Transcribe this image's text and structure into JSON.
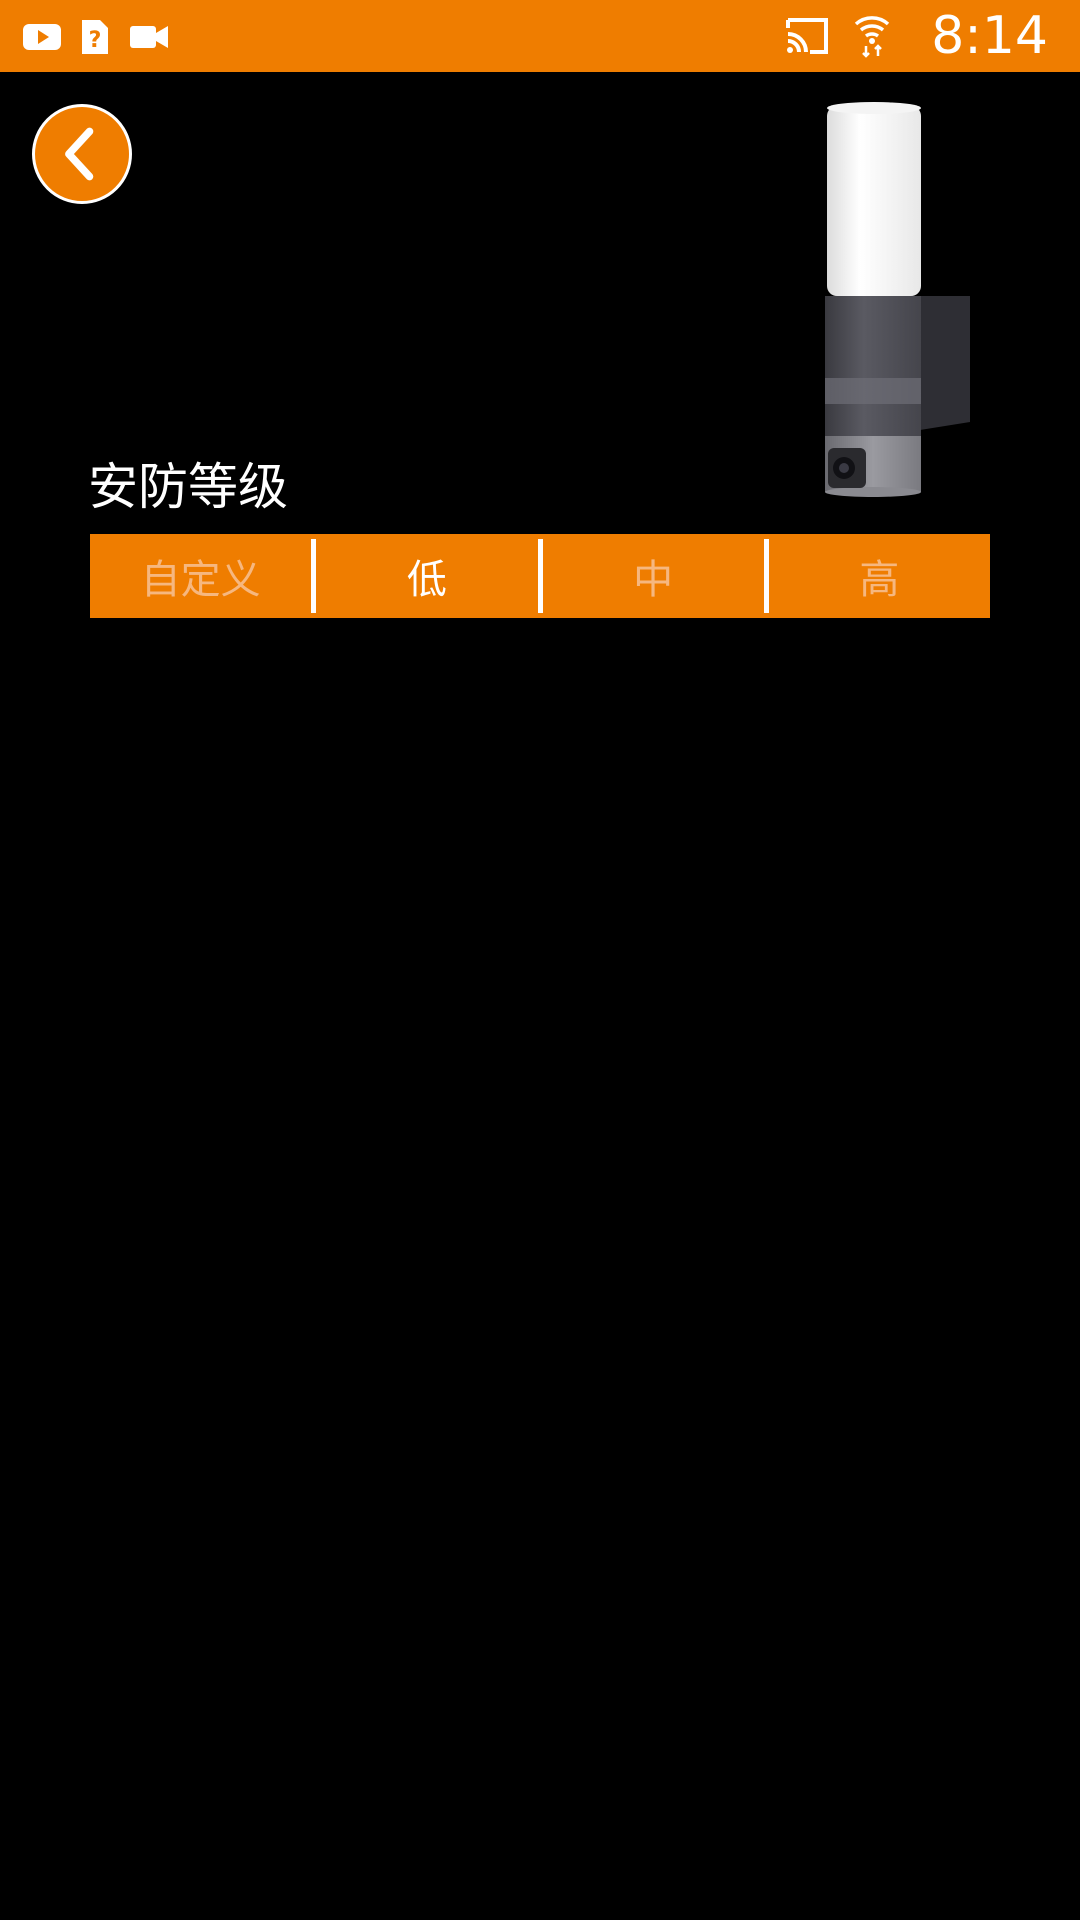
{
  "status_bar": {
    "background_color": "#EF7D00",
    "left_icons": [
      "youtube-icon",
      "sim-unknown-icon",
      "video-camera-icon"
    ],
    "right_icons": [
      "cast-icon",
      "wifi-icon"
    ],
    "time": "8:14"
  },
  "header": {
    "back_button_icon": "chevron-left-icon"
  },
  "device_image": {
    "description_icon": "outdoor-camera-light-icon"
  },
  "security_level": {
    "title": "安防等级",
    "options": [
      {
        "label": "自定义",
        "selected": false
      },
      {
        "label": "低",
        "selected": true
      },
      {
        "label": "中",
        "selected": false
      },
      {
        "label": "高",
        "selected": false
      }
    ],
    "accent_color": "#EF7D00",
    "inactive_text_color": "#F6B77F",
    "active_text_color": "#FFFFFF"
  }
}
